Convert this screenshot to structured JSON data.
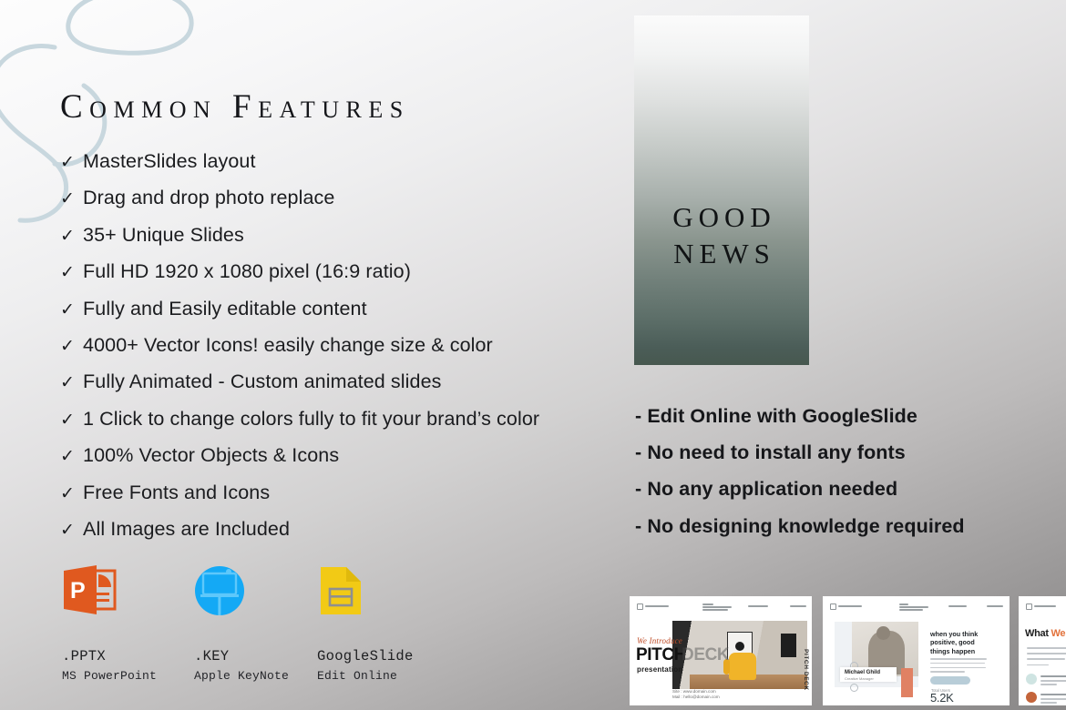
{
  "left": {
    "title": "Common Features",
    "check_glyph": "✓",
    "features": [
      "MasterSlides layout",
      "Drag and drop photo replace",
      "35+ Unique Slides",
      "Full HD 1920 x 1080 pixel (16:9 ratio)",
      "Fully and Easily editable content",
      "4000+ Vector Icons! easily change size & color",
      "Fully Animated - Custom animated slides",
      "1 Click to change colors fully to fit your brand’s color",
      "100% Vector Objects & Icons",
      "Free Fonts and Icons",
      "All Images are Included"
    ]
  },
  "formats": [
    {
      "icon": "powerpoint-icon",
      "ext": ".PPTX",
      "sub": "MS PowerPoint",
      "color": "#e0591f"
    },
    {
      "icon": "keynote-icon",
      "ext": ".KEY",
      "sub": "Apple KeyNote",
      "color": "#14a9f5"
    },
    {
      "icon": "googleslides-icon",
      "ext": "GoogleSlide",
      "sub": "Edit Online",
      "color": "#f2ca15"
    }
  ],
  "panel": {
    "line1": "GOOD",
    "line2": "NEWS",
    "gradient_top": "#fbfbfb",
    "gradient_bottom": "#47584f"
  },
  "right_bullets": [
    "- Edit Online with GoogleSlide",
    "- No need to install any fonts",
    "- No any application needed",
    "- No designing knowledge required"
  ],
  "thumbnails": {
    "one": {
      "script": "We Introduce",
      "title_dark": "PITCH",
      "title_light": "DECK",
      "subtitle": "presentation",
      "vertical": "PITCH DECK",
      "contact_line1": "Site   : www.domain.com",
      "contact_line2": "Mail  : hello@domain.com"
    },
    "two": {
      "headline": "when you think positive, good things happen",
      "name": "Michael Ghild",
      "role": "Creative Manager",
      "stat_label": "Total Users",
      "stat_value": "5.2K"
    },
    "three": {
      "title_black": "What ",
      "title_accent": "We Offer",
      "title_tail": "?"
    }
  },
  "colors": {
    "background_top": "#fdfdfd",
    "background_bottom": "#8b8989",
    "doodle": "#c9d8de",
    "accent_orange": "#e2713a",
    "text": "#1b1c1f"
  }
}
